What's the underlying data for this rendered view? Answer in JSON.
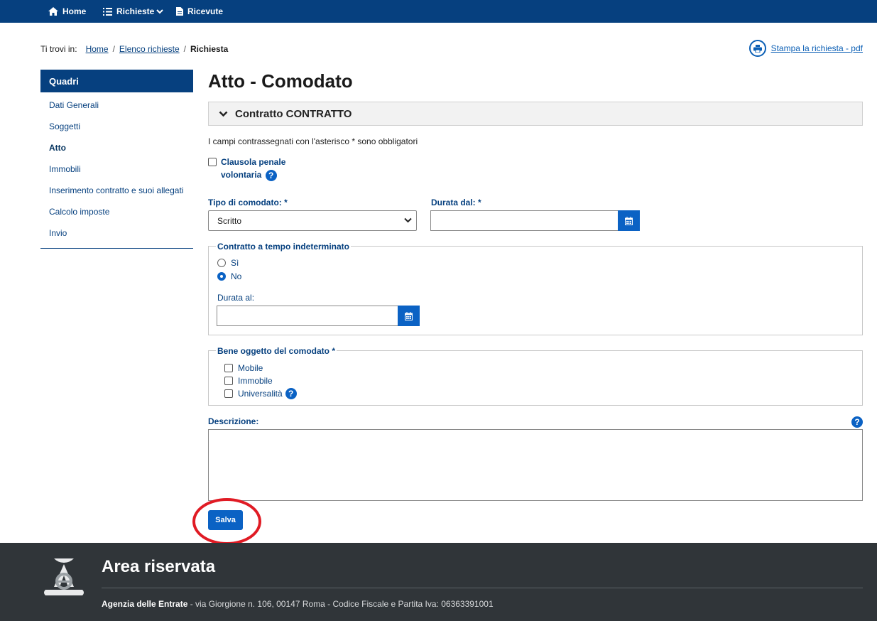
{
  "topnav": {
    "home": "Home",
    "richieste": "Richieste",
    "ricevute": "Ricevute"
  },
  "breadcrumb": {
    "label": "Ti trovi in:",
    "items": [
      "Home",
      "Elenco richieste"
    ],
    "current": "Richiesta"
  },
  "print_link": "Stampa la richiesta - pdf",
  "sidebar": {
    "title": "Quadri",
    "items": [
      {
        "label": "Dati Generali"
      },
      {
        "label": "Soggetti"
      },
      {
        "label": "Atto",
        "active": true
      },
      {
        "label": "Immobili"
      },
      {
        "label": "Inserimento contratto e suoi allegati"
      },
      {
        "label": "Calcolo imposte"
      },
      {
        "label": "Invio"
      }
    ]
  },
  "main": {
    "title": "Atto - Comodato",
    "section": "Contratto CONTRATTO",
    "required_note": "I campi contrassegnati con l'asterisco * sono obbligatori",
    "clausola": {
      "line1": "Clausola penale",
      "line2": "volontaria",
      "checked": false
    },
    "tipo_label": "Tipo di comodato: *",
    "tipo_value": "Scritto",
    "durata_dal_label": "Durata dal: *",
    "durata_dal_value": "",
    "indeterminato": {
      "legend": "Contratto a tempo indeterminato",
      "options": [
        "Sì",
        "No"
      ],
      "selected": "No",
      "durata_al_label": "Durata al:",
      "durata_al_value": ""
    },
    "bene": {
      "legend": "Bene oggetto del comodato *",
      "options": [
        "Mobile",
        "Immobile",
        "Universalità"
      ]
    },
    "descrizione_label": "Descrizione:",
    "descrizione_value": "",
    "save_label": "Salva"
  },
  "footer": {
    "title": "Area riservata",
    "org": "Agenzia delle Entrate",
    "address": " - via Giorgione n. 106, 00147 Roma - Codice Fiscale e Partita Iva: 06363391001"
  },
  "colors": {
    "nav_bg": "#06407f",
    "accent": "#0b62c4",
    "footer_bg": "#303539",
    "highlight_ring": "#e01b24"
  }
}
